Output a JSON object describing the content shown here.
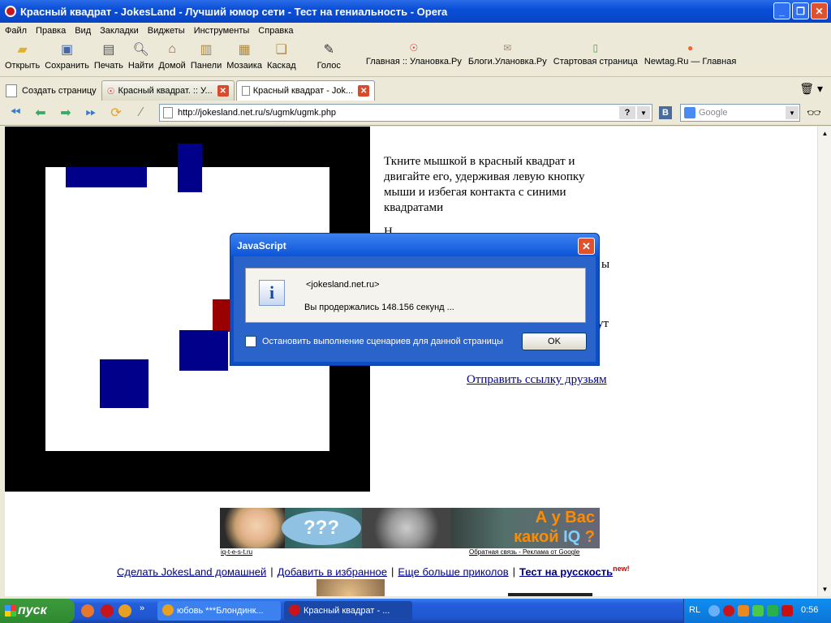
{
  "window": {
    "title": "Красный квадрат - JokesLand - Лучший юмор сети - Тест на гениальность - Opera"
  },
  "menu": [
    "Файл",
    "Правка",
    "Вид",
    "Закладки",
    "Виджеты",
    "Инструменты",
    "Справка"
  ],
  "toolbar": {
    "buttons": [
      "Открыть",
      "Сохранить",
      "Печать",
      "Найти",
      "Домой",
      "Панели",
      "Мозаика",
      "Каскад",
      "Голос"
    ],
    "bookmarks": [
      "Главная :: Улановка.Ру",
      "Блоги.Улановка.Ру",
      "Стартовая страница",
      "Newtag.Ru — Главная"
    ]
  },
  "tabs": {
    "new_tab": "Создать страницу",
    "items": [
      {
        "label": "Красный квадрат. :: У..."
      },
      {
        "label": "Красный квадрат - Jok..."
      }
    ]
  },
  "address": {
    "url": "http://jokesland.net.ru/s/ugmk/ugmk.php",
    "help": "?",
    "vk": "B",
    "search_placeholder": "Google"
  },
  "page": {
    "instructions": "Ткните мышкой в красный квадрат и двигайте его, удерживая левую кнопку мыши и избегая контакта с синими квадратами",
    "hidden_fragment_1": "Н",
    "hidden_fragment_2": "ы",
    "hidden_fragment_3": "ут",
    "send_link": "Отправить ссылку друзьям",
    "banner": {
      "bubble": "???",
      "iq_line1": "А у Вас",
      "iq_line2_pre": "какой ",
      "iq_word": "IQ",
      "iq_q": " ?",
      "left_link": "iq-t-e-s-t.ru",
      "right_link": "Обратная связь - Реклама от Google"
    },
    "footer": {
      "links": [
        "Сделать JokesLand домашней",
        "Добавить в избранное",
        "Еще больше приколов"
      ],
      "bold_link": "Тест на русскость",
      "new_badge": "new!",
      "separator": "|"
    }
  },
  "dialog": {
    "title": "JavaScript",
    "icon": "i",
    "host": "<jokesland.net.ru>",
    "message": "Вы продержались 148.156 секунд ...",
    "checkbox_label": "Остановить выполнение сценариев для данной страницы",
    "ok": "OK"
  },
  "taskbar": {
    "start": "пуск",
    "tasks": [
      {
        "label": "юбовь ***Блондинк..."
      },
      {
        "label": "Красный квадрат - ..."
      }
    ],
    "lang": "RL",
    "time": "0:56"
  },
  "colors": {
    "blue_square": "#00008b",
    "red_square": "#990000",
    "link": "#00008b"
  }
}
